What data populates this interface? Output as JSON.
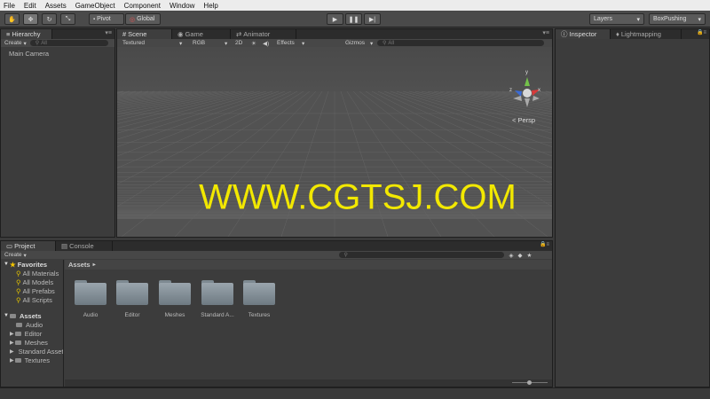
{
  "menu": [
    "File",
    "Edit",
    "Assets",
    "GameObject",
    "Component",
    "Window",
    "Help"
  ],
  "toolbar": {
    "pivot": "Pivot",
    "global": "Global",
    "layers": "Layers",
    "layout": "BoxPushing"
  },
  "hierarchy": {
    "tab": "Hierarchy",
    "create": "Create",
    "search_placeholder": "All",
    "items": [
      "Main Camera"
    ]
  },
  "scene": {
    "tabs": [
      "Scene",
      "Game",
      "Animator"
    ],
    "render_mode": "Textured",
    "color_mode": "RGB",
    "two_d": "2D",
    "effects": "Effects",
    "gizmos": "Gizmos",
    "search_placeholder": "All",
    "persp": "Persp",
    "axis_x": "x",
    "axis_y": "y",
    "axis_z": "z",
    "watermark": "WWW.CGTSJ.COM"
  },
  "inspector": {
    "tabs": [
      "Inspector",
      "Lightmapping"
    ]
  },
  "project": {
    "tabs": [
      "Project",
      "Console"
    ],
    "create": "Create",
    "favorites_label": "Favorites",
    "favorites": [
      "All Materials",
      "All Models",
      "All Prefabs",
      "All Scripts"
    ],
    "assets_label": "Assets",
    "asset_tree": [
      "Audio",
      "Editor",
      "Meshes",
      "Standard Assets",
      "Textures"
    ],
    "breadcrumb": "Assets",
    "folders": [
      "Audio",
      "Editor",
      "Meshes",
      "Standard A...",
      "Textures"
    ]
  },
  "colors": {
    "watermark": "#f2e800",
    "gizmo_x": "#d83a3a",
    "gizmo_y": "#74c24a",
    "gizmo_z": "#3a6bd8"
  }
}
